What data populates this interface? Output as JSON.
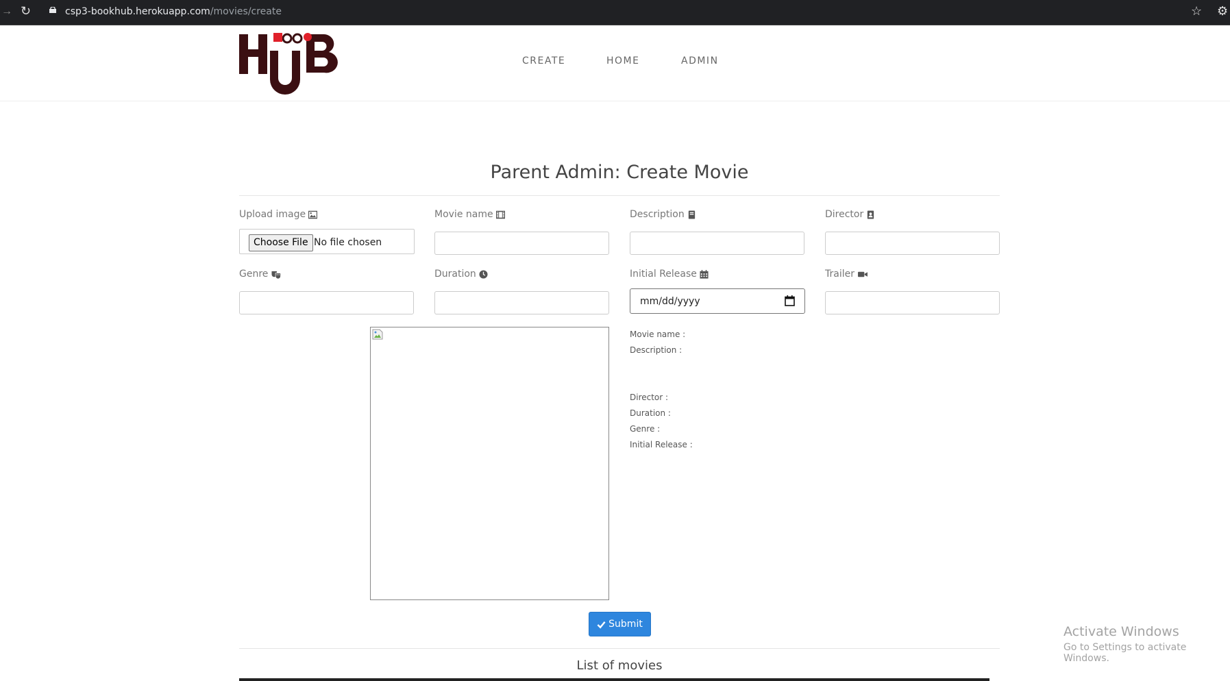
{
  "browser": {
    "url_host": "csp3-bookhub.herokuapp.com",
    "url_path": "/movies/create"
  },
  "nav": {
    "items": [
      {
        "label": "CREATE"
      },
      {
        "label": "HOME"
      },
      {
        "label": "ADMIN"
      }
    ]
  },
  "page": {
    "title": "Parent Admin: Create Movie"
  },
  "form": {
    "upload_label": "Upload image",
    "file_button": "Choose File",
    "file_status": "No file chosen",
    "movie_name_label": "Movie name",
    "description_label": "Description",
    "director_label": "Director",
    "genre_label": "Genre",
    "duration_label": "Duration",
    "initial_release_label": "Initial Release",
    "initial_release_placeholder": "mm/dd/yyyy",
    "trailer_label": "Trailer"
  },
  "preview": {
    "movie_name": "Movie name :",
    "description": "Description :",
    "director": "Director :",
    "duration": "Duration :",
    "genre": "Genre :",
    "initial_release": "Initial Release :"
  },
  "actions": {
    "submit_label": "Submit"
  },
  "list": {
    "title": "List of movies"
  },
  "watermark": {
    "line1": "Activate Windows",
    "line2": "Go to Settings to activate Windows."
  },
  "colors": {
    "primary": "#2e86de",
    "logo": "#3b0f12",
    "logo_accent": "#e0202a"
  }
}
